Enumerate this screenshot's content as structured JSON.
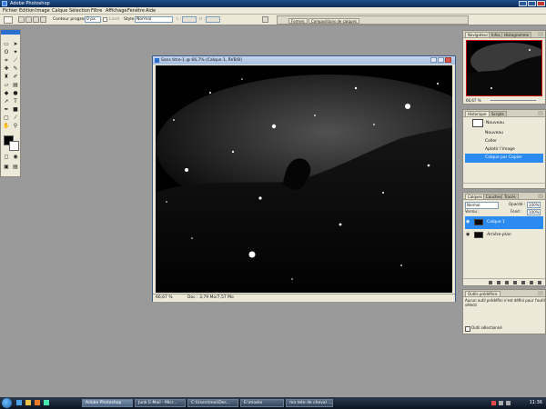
{
  "app": {
    "title": "Adobe Photoshop"
  },
  "menu": [
    "Fichier",
    "Edition",
    "Image",
    "Calque",
    "Sélection",
    "Filtre",
    "Affichage",
    "Fenêtre",
    "Aide"
  ],
  "options": {
    "feather_label": "Contour progressif :",
    "feather_value": "0 px",
    "lisse_label": "Lissé",
    "style_label": "Style :",
    "style_value": "Normal",
    "width_label": "L :",
    "height_label": "H :"
  },
  "palette_well": {
    "tabs": [
      "Formes",
      "Compositions de calques"
    ]
  },
  "document": {
    "title": "Sans titre-1 @ 66,7% (Calque 1, RVB/8)",
    "zoom": "66,67 %",
    "doc_info": "Doc : 3,79 Mo/7,57 Mo"
  },
  "navigator": {
    "tabs": [
      "Navigateur",
      "Infos",
      "Histogramme"
    ],
    "zoom": "66,67 %"
  },
  "history": {
    "tabs": [
      "Historique",
      "Scripts"
    ],
    "snapshot": "Nouveau",
    "items": [
      "Nouveau",
      "Coller",
      "Aplatir l'image",
      "Calque par Copier"
    ],
    "selected_index": 3
  },
  "layers": {
    "tabs": [
      "Calques",
      "Couches",
      "Tracés"
    ],
    "blend_mode": "Normal",
    "opacity_label": "Opacité :",
    "opacity_value": "100%",
    "lock_label": "Verrou :",
    "fill_label": "Fond :",
    "fill_value": "100%",
    "items": [
      "Calque 1",
      "Arrière-plan"
    ],
    "selected_index": 0
  },
  "tool_presets": {
    "tab": "Outils prédéfinis",
    "message": "Aucun outil prédéfini n'est défini pour l'outil sélecti",
    "checkbox_label": "Outil sélectionné"
  },
  "taskbar": {
    "buttons": [
      "Adobe Photoshop",
      "Junk E-Mail - Micr...",
      "C:\\Users\\moi\\Des...",
      "E:\\masks",
      "ma tete de cheval ..."
    ],
    "active_index": 0,
    "clock": "11:36"
  },
  "colors": {
    "selection_blue": "#2b8bf0",
    "panel_bg": "#ece9d8",
    "workspace": "#9a9a9a",
    "canvas_bg": "#000000"
  }
}
